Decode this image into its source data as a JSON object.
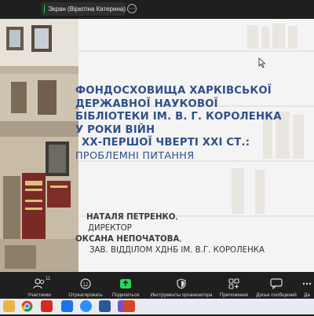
{
  "top_bar": {
    "share_label": "Экран (Вірютіна Катерина)",
    "more_glyph": "···",
    "share_color": "#23d959"
  },
  "slide": {
    "title_lines": [
      "ФОНДОСХОВИЩА ХАРКІВСЬКОЇ",
      "ДЕРЖАВНОЇ НАУКОВОЇ",
      "БІБЛІОТЕКИ ІМ. В. Г. КОРОЛЕНКА",
      "У РОКИ ВІЙН",
      "ХХ-ПЕРШОЇ ЧВЕРТІ ХХІ СТ.:"
    ],
    "subtitle": "ПРОБЛЕМНІ ПИТАННЯ",
    "author1_name": "НАТАЛЯ ПЕТРЕНКО",
    "author1_suffix": ",",
    "author1_role": "ДИРЕКТОР",
    "author2_name": "ОКСАНА НЕПОЧАТОВА",
    "author2_suffix": ",",
    "author2_role": "ЗАВ. ВІДДІЛОМ ХДНБ ІМ. В.Г. КОРОЛЕНКА",
    "title_color": "#2f4f8a"
  },
  "toolbar": {
    "participants_label": "Участники",
    "participants_count": "11",
    "react_label": "Отреагировать",
    "share_label": "Поделиться",
    "host_tools_label": "Инструменты организатора",
    "apps_label": "Приложения",
    "messages_label": "Досье сообщений",
    "more_label": "Да"
  },
  "taskbar": {
    "icons": [
      "file-manager-icon",
      "chrome-icon",
      "acrobat-icon",
      "mail-icon",
      "zoom-icon",
      "word-icon",
      "app-icon",
      "powerpoint-icon"
    ]
  }
}
